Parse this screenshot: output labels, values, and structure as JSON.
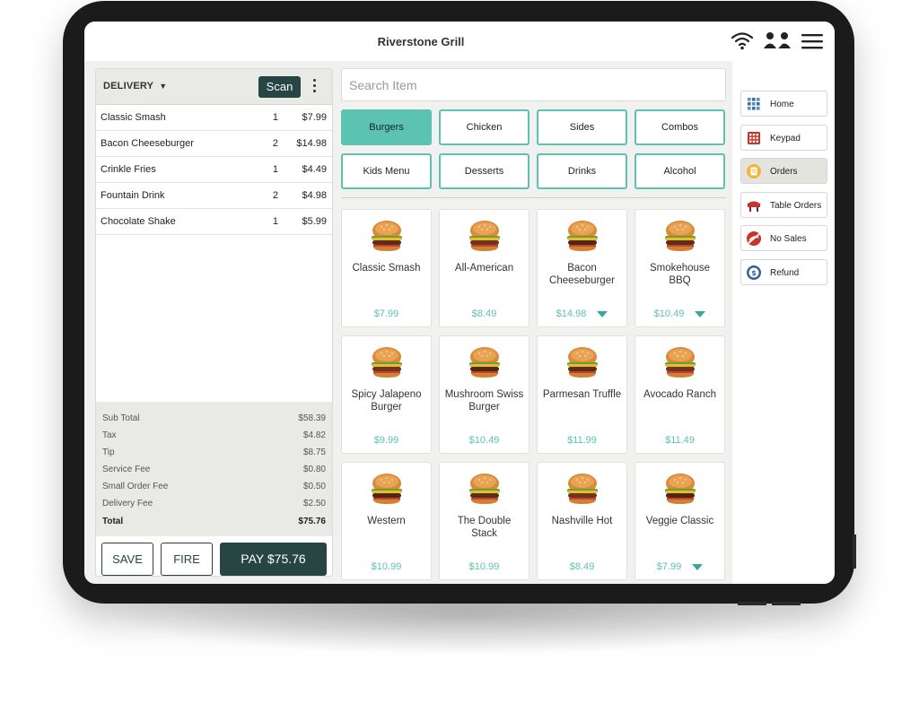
{
  "app": {
    "title": "Riverstone Grill"
  },
  "order": {
    "type": "DELIVERY",
    "scan_label": "Scan",
    "items": [
      {
        "name": "Classic Smash",
        "qty": "1",
        "price": "$7.99"
      },
      {
        "name": "Bacon Cheeseburger",
        "qty": "2",
        "price": "$14.98"
      },
      {
        "name": "Crinkle Fries",
        "qty": "1",
        "price": "$4.49"
      },
      {
        "name": "Fountain Drink",
        "qty": "2",
        "price": "$4.98"
      },
      {
        "name": "Chocolate Shake",
        "qty": "1",
        "price": "$5.99"
      }
    ],
    "totals": [
      {
        "label": "Sub Total",
        "value": "$58.39"
      },
      {
        "label": "Tax",
        "value": "$4.82"
      },
      {
        "label": "Tip",
        "value": "$8.75"
      },
      {
        "label": "Service Fee",
        "value": "$0.80"
      },
      {
        "label": "Small Order Fee",
        "value": "$0.50"
      },
      {
        "label": "Delivery Fee",
        "value": "$2.50"
      },
      {
        "label": "Total",
        "value": "$75.76"
      }
    ],
    "save_label": "SAVE",
    "fire_label": "FIRE",
    "pay_label": "PAY $75.76"
  },
  "search": {
    "placeholder": "Search Item"
  },
  "categories": [
    {
      "label": "Burgers",
      "active": true
    },
    {
      "label": "Chicken"
    },
    {
      "label": "Sides"
    },
    {
      "label": "Combos"
    },
    {
      "label": "Kids Menu"
    },
    {
      "label": "Desserts"
    },
    {
      "label": "Drinks"
    },
    {
      "label": "Alcohol"
    }
  ],
  "menu_items": [
    {
      "name": "Classic Smash",
      "price": "$7.99",
      "options": false
    },
    {
      "name": "All-American",
      "price": "$8.49",
      "options": false
    },
    {
      "name": "Bacon Cheeseburger",
      "price": "$14.98",
      "options": true
    },
    {
      "name": "Smokehouse BBQ",
      "price": "$10.49",
      "options": true
    },
    {
      "name": "Spicy Jalapeno Burger",
      "price": "$9.99",
      "options": false
    },
    {
      "name": "Mushroom Swiss Burger",
      "price": "$10.49",
      "options": false
    },
    {
      "name": "Parmesan Truffle",
      "price": "$11.99",
      "options": false
    },
    {
      "name": "Avocado Ranch",
      "price": "$11.49",
      "options": false
    },
    {
      "name": "Western",
      "price": "$10.99",
      "options": false
    },
    {
      "name": "The Double Stack",
      "price": "$10.99",
      "options": false
    },
    {
      "name": "Nashville Hot",
      "price": "$8.49",
      "options": false
    },
    {
      "name": "Veggie Classic",
      "price": "$7.99",
      "options": true
    }
  ],
  "nav": [
    {
      "label": "Home",
      "icon": "home-grid-icon"
    },
    {
      "label": "Keypad",
      "icon": "keypad-icon"
    },
    {
      "label": "Orders",
      "icon": "orders-icon",
      "selected": true
    },
    {
      "label": "Table Orders",
      "icon": "table-icon"
    },
    {
      "label": "No Sales",
      "icon": "no-sales-icon"
    },
    {
      "label": "Refund",
      "icon": "refund-icon"
    }
  ],
  "colors": {
    "accent": "#5cc2b2",
    "dark": "#274542",
    "price": "#5cc2b2"
  }
}
